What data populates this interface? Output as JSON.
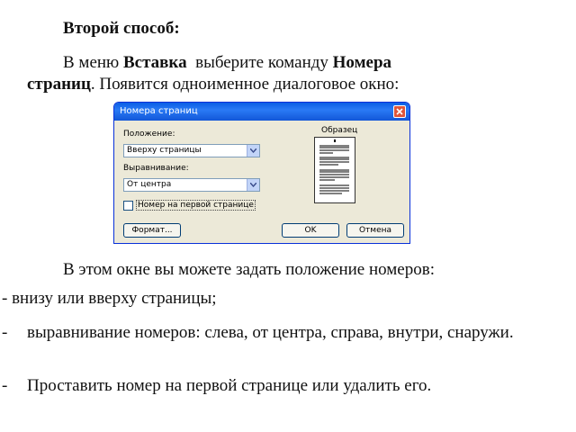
{
  "text": {
    "heading": "Второй способ:",
    "line1_pre": "В меню ",
    "line1_menu": "Вставка",
    "line1_mid": "  выберите команду ",
    "line1_cmd": "Номера",
    "line2_cmd": "страниц",
    "line2_post": ". Появится одноименное диалоговое окно:",
    "intro": "В этом окне вы можете задать положение номеров:",
    "item1": "- внизу или вверху страницы;",
    "item2_dash": "-",
    "item2": "выравнивание номеров: слева, от центра, справа, внутри, снаружи.",
    "item3_dash": "-",
    "item3": "Проставить номер на первой странице или удалить его."
  },
  "dialog": {
    "title": "Номера страниц",
    "position_label": "Положение:",
    "position_value": "Вверху страницы",
    "align_label": "Выравнивание:",
    "align_value": "От центра",
    "first_page_checkbox": "Номер на первой странице",
    "first_page_checked": false,
    "preview_label": "Образец",
    "format_button": "Формат...",
    "ok_button": "OK",
    "cancel_button": "Отмена"
  },
  "colors": {
    "titlebar": "#0a5ee5",
    "dialog_bg": "#ece9d8",
    "close_button": "#e0563a"
  }
}
